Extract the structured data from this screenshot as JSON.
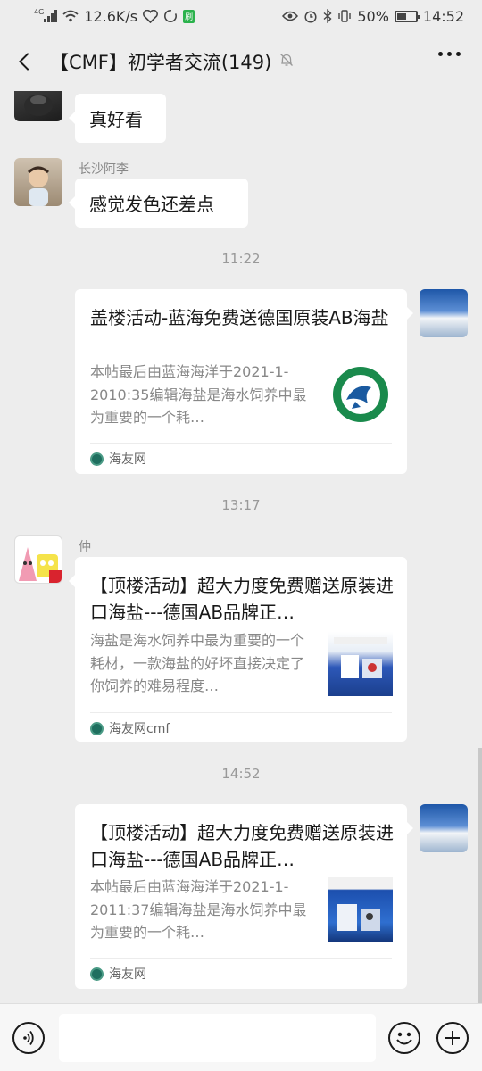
{
  "status_bar": {
    "network_type": "4G",
    "speed": "12.6K/s",
    "battery": "50%",
    "time": "14:52",
    "badge": "刷"
  },
  "header": {
    "title": "【CMF】初学者交流(149)"
  },
  "messages": [
    {
      "type": "text",
      "sender": "",
      "text": "真好看"
    },
    {
      "type": "text",
      "sender": "长沙阿李",
      "text": "感觉发色还差点"
    },
    {
      "type": "time",
      "text": "11:22"
    },
    {
      "type": "card",
      "side": "right",
      "title": "盖楼活动-蓝海免费送德国原装AB海盐",
      "desc": "本帖最后由蓝海海洋于2021-1-2010:35编辑海盐是海水饲养中最为重要的一个耗…",
      "source": "海友网"
    },
    {
      "type": "time",
      "text": "13:17"
    },
    {
      "type": "card",
      "side": "left",
      "sender": "仲",
      "title": "【顶楼活动】超大力度免费赠送原装进口海盐---德国AB品牌正…",
      "desc": "海盐是海水饲养中最为重要的一个耗材，一款海盐的好坏直接决定了你饲养的难易程度…",
      "source": "海友网cmf"
    },
    {
      "type": "time",
      "text": "14:52"
    },
    {
      "type": "card",
      "side": "right",
      "title": "【顶楼活动】超大力度免费赠送原装进口海盐---德国AB品牌正…",
      "desc": "本帖最后由蓝海海洋于2021-1-2011:37编辑海盐是海水饲养中最为重要的一个耗…",
      "source": "海友网"
    }
  ],
  "input_bar": {
    "value": "",
    "placeholder": ""
  },
  "icons": {
    "back": "chevron-left-icon",
    "mute": "bell-off-icon",
    "more": "more-dots-icon",
    "voice": "voice-icon",
    "emoji": "emoji-icon",
    "add": "plus-icon"
  },
  "colors": {
    "background": "#ededed",
    "bubble": "#ffffff",
    "text": "#191919",
    "muted": "#888888"
  }
}
